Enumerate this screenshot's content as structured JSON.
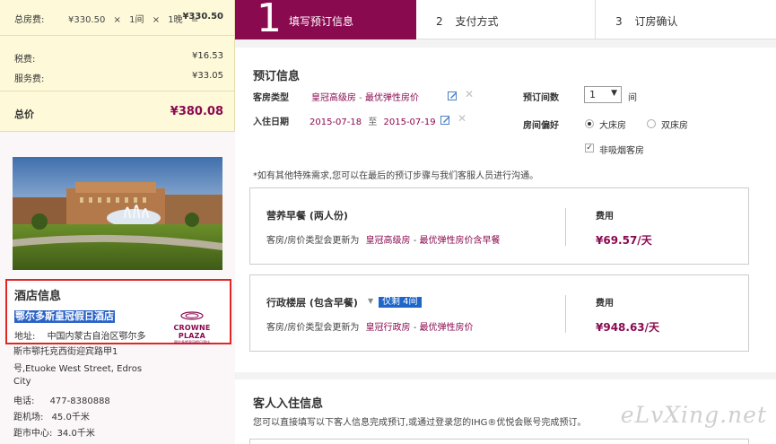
{
  "price": {
    "room_label": "总房费:",
    "room_calc_parts": [
      "¥330.50",
      "×",
      "1间",
      "×",
      "1晚",
      "="
    ],
    "room_value": "¥330.50",
    "tax_label": "税费:",
    "tax_value": "¥16.53",
    "service_label": "服务费:",
    "service_value": "¥33.05",
    "total_label": "总价",
    "total_value": "¥380.08"
  },
  "hotel": {
    "section_title": "酒店信息",
    "name": "鄂尔多斯皇冠假日酒店",
    "logo_text": "CROWNE PLAZA",
    "logo_sub": "鄂尔多斯皇冠假日酒店",
    "address_label": "地址:",
    "address_line1": "中国内蒙古自治区鄂尔多",
    "address_line2": "斯市鄂托克西街迎宾路甲1",
    "address_line3": "号,Etuoke West Street, Edros",
    "address_line4": "City",
    "phone_label": "电话:",
    "phone": "477-8380888",
    "airport_label": "距机场:",
    "airport": "45.0千米",
    "center_label": "距市中心:",
    "center": "34.0千米"
  },
  "steps": [
    {
      "num": "1",
      "label": "填写预订信息"
    },
    {
      "num": "2",
      "label": "支付方式"
    },
    {
      "num": "3",
      "label": "订房确认"
    }
  ],
  "booking": {
    "title": "预订信息",
    "room_type_label": "客房类型",
    "room_type_value": "皇冠高级房",
    "room_type_sep": " - ",
    "room_type_rate": "最优弹性房价",
    "checkin_label": "入住日期",
    "checkin_from": "2015-07-18",
    "checkin_to_word": "至",
    "checkin_to": "2015-07-19",
    "rooms_label": "预订间数",
    "rooms_value": "1",
    "rooms_unit": "间",
    "pref_label": "房间偏好",
    "bed_king": "大床房",
    "bed_twin": "双床房",
    "nonsmoking": "非吸烟客房",
    "note": "*如有其他特殊需求,您可以在最后的预订步骤与我们客服人员进行沟通。"
  },
  "upsells": [
    {
      "title": "营养早餐 (两人份)",
      "desc_prefix": "客房/房价类型会更新为",
      "desc_room": "皇冠高级房",
      "desc_sep": " - ",
      "desc_rate": "最优弹性房价含早餐",
      "fee_label": "费用",
      "price": "¥69.57/天"
    },
    {
      "title": "行政楼层 (包含早餐)",
      "badge": "仅剩 4间",
      "desc_prefix": "客房/房价类型会更新为",
      "desc_room": "皇冠行政房",
      "desc_sep": " - ",
      "desc_rate": "最优弹性房价",
      "fee_label": "费用",
      "price": "¥948.63/天"
    }
  ],
  "guest": {
    "title": "客人入住信息",
    "desc": "您可以直接填写以下客人信息完成预订,或通过登录您的IHG®优悦会账号完成预订。"
  },
  "watermark": "eLvXing.net",
  "colors": {
    "brand": "#8a0a50",
    "highlight": "#2a63c8",
    "badge": "#1e66c9",
    "price_bg": "#fdf9d9"
  }
}
